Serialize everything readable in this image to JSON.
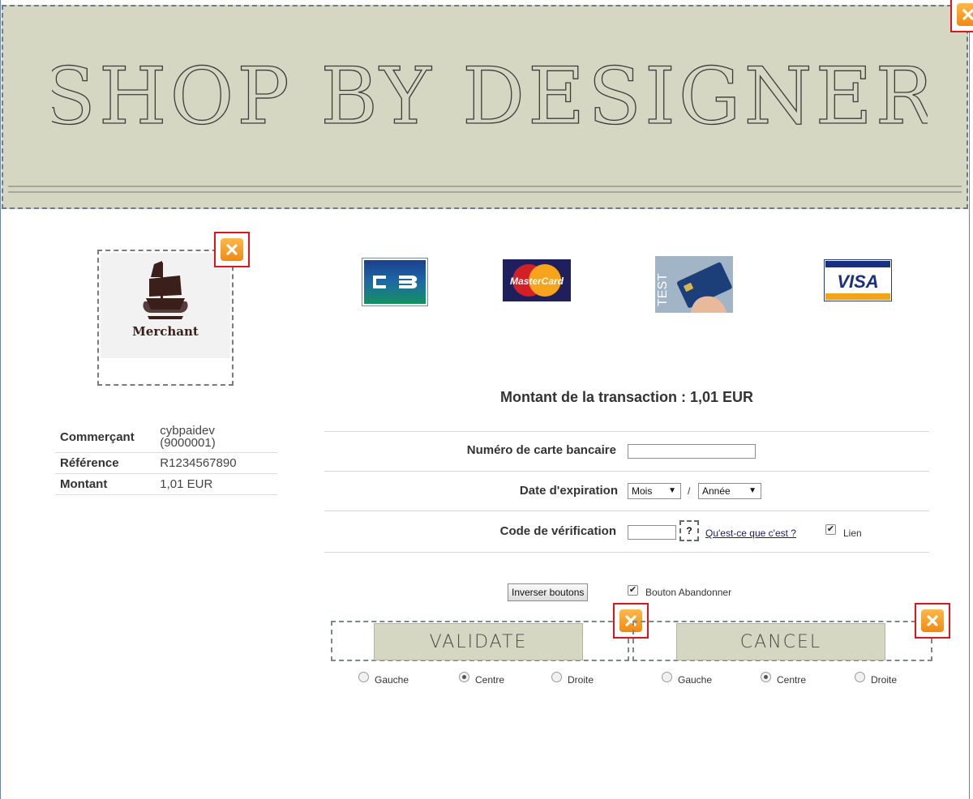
{
  "banner": {
    "title": "SHOP BY DESIGNER"
  },
  "merchant_logo": {
    "name": "Merchant"
  },
  "cards": [
    "CB",
    "MasterCard",
    "TEST",
    "VISA"
  ],
  "merchant_info": {
    "rows": [
      {
        "label": "Commerçant",
        "value": "cybpaidev (9000001)"
      },
      {
        "label": "Référence",
        "value": "R1234567890"
      },
      {
        "label": "Montant",
        "value": "1,01 EUR"
      }
    ]
  },
  "transaction": {
    "title": "Montant de la transaction : 1,01 EUR",
    "card_number_label": "Numéro de carte bancaire",
    "card_number_value": "",
    "expiry_label": "Date d'expiration",
    "month_select": "Mois",
    "year_select": "Année",
    "slash": "/",
    "cvv_label": "Code de vérification",
    "cvv_value": "",
    "cvv_help": "?",
    "cvv_link": "Qu'est-ce que c'est ?",
    "link_checkbox_label": "Lien",
    "link_checkbox_checked": true
  },
  "buttons": {
    "invert_label": "Inverser boutons",
    "cancel_checkbox_label": "Bouton Abandonner",
    "cancel_checkbox_checked": true,
    "validate_label": "VALIDATE",
    "cancel_label": "CANCEL",
    "align_left": "Gauche",
    "align_center": "Centre",
    "align_right": "Droite",
    "validate_alignment": "Centre",
    "cancel_alignment": "Centre"
  },
  "colors": {
    "banner_bg": "#d6d7c3",
    "remove_icon": "#f08a12",
    "remove_frame": "#e0141a"
  }
}
